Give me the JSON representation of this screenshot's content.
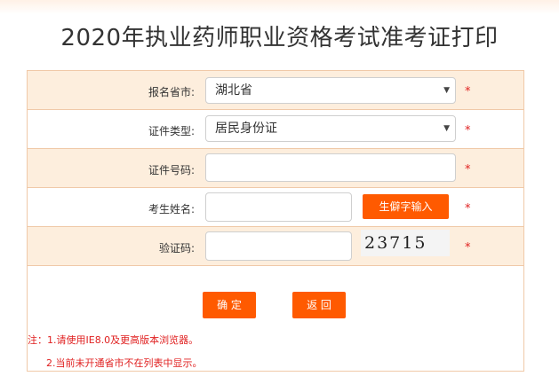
{
  "page": {
    "title": "2020年执业药师职业资格考试准考证打印"
  },
  "form": {
    "province": {
      "label": "报名省市:",
      "value": "湖北省"
    },
    "id_type": {
      "label": "证件类型:",
      "value": "居民身份证"
    },
    "id_number": {
      "label": "证件号码:",
      "value": "",
      "placeholder": ""
    },
    "name": {
      "label": "考生姓名:",
      "value": "",
      "rare_char_button": "生僻字输入"
    },
    "captcha": {
      "label": "验证码:",
      "value": "",
      "code": "23715"
    },
    "required_mark": "*"
  },
  "buttons": {
    "confirm": "确 定",
    "back": "返 回"
  },
  "notes": {
    "line1": "注：1.请使用IE8.0及更高版本浏览器。",
    "line2": "2.当前未开通省市不在列表中显示。"
  },
  "colors": {
    "accent": "#ff5a00",
    "row_shade": "#fdeedd",
    "border": "#f0c9a8",
    "required": "#e02020"
  },
  "icons": {
    "select_arrow": "chevron-down-icon"
  }
}
